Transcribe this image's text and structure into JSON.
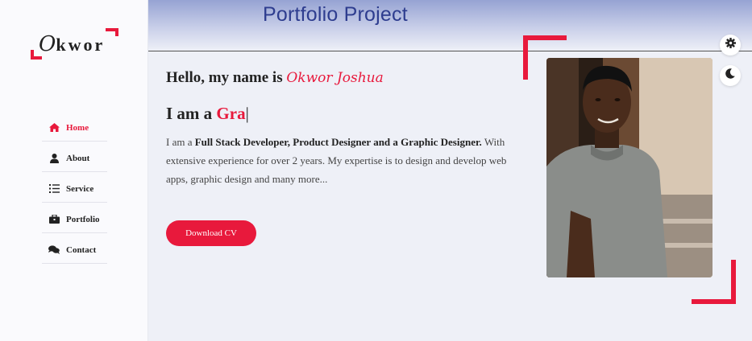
{
  "header": {
    "title": "Portfolio Project"
  },
  "logo": {
    "initial": "O",
    "rest": "kwor"
  },
  "nav": [
    {
      "label": "Home",
      "icon": "home-icon",
      "active": true
    },
    {
      "label": "About",
      "icon": "user-icon",
      "active": false
    },
    {
      "label": "Service",
      "icon": "list-icon",
      "active": false
    },
    {
      "label": "Portfolio",
      "icon": "briefcase-icon",
      "active": false
    },
    {
      "label": "Contact",
      "icon": "chat-icon",
      "active": false
    }
  ],
  "hero": {
    "greeting": "Hello, my name is",
    "name": "Okwor Joshua",
    "iam_prefix": "I am a",
    "typed": "Gra",
    "cursor": "|",
    "desc_prefix": "I am a",
    "desc_bold": "Full Stack Developer, Product Designer and a Graphic Designer.",
    "desc_rest": "With extensive experience for over 2 years. My expertise is to design and develop web apps, graphic design and many more...",
    "cv_button": "Download CV"
  },
  "controls": {
    "settings_icon": "gear-icon",
    "theme_icon": "moon-icon"
  },
  "colors": {
    "accent": "#e8193c",
    "title": "#2e3d8f",
    "background": "#eef0f7"
  }
}
